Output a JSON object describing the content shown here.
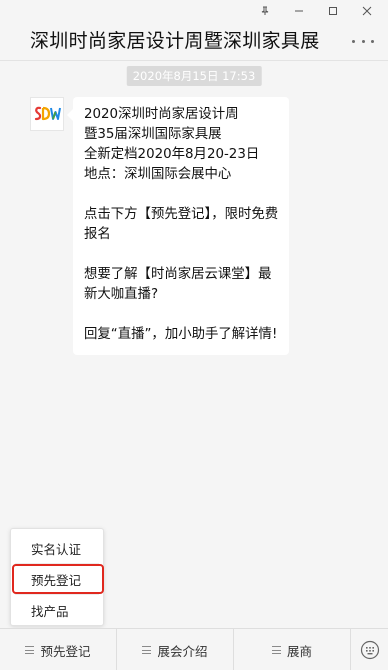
{
  "window": {
    "pin_icon": "pin-icon",
    "minimize_icon": "minimize-icon",
    "maximize_icon": "maximize-icon",
    "close_icon": "close-icon"
  },
  "header": {
    "title": "深圳时尚家居设计周暨深圳家具展",
    "more_icon": "more-icon"
  },
  "chat": {
    "timestamp": "2020年8月15日 17:53",
    "message_lines": [
      "2020深圳时尚家居设计周",
      "暨35届深圳国际家具展",
      "全新定档2020年8月20-23日",
      "地点：深圳国际会展中心",
      "",
      "点击下方【预先登记】，限时免费报名",
      "",
      "想要了解【时尚家居云课堂】最新大咖直播?",
      "",
      "回复“直播”，加小助手了解详情!"
    ]
  },
  "popup_menu": {
    "items": [
      "实名认证",
      "预先登记",
      "找产品"
    ],
    "highlighted": "预先登记",
    "highlight_color": "#e0281e"
  },
  "bottom_menu": {
    "tabs": [
      "预先登记",
      "展会介绍",
      "展商"
    ],
    "keyboard_icon": "keyboard-icon"
  }
}
